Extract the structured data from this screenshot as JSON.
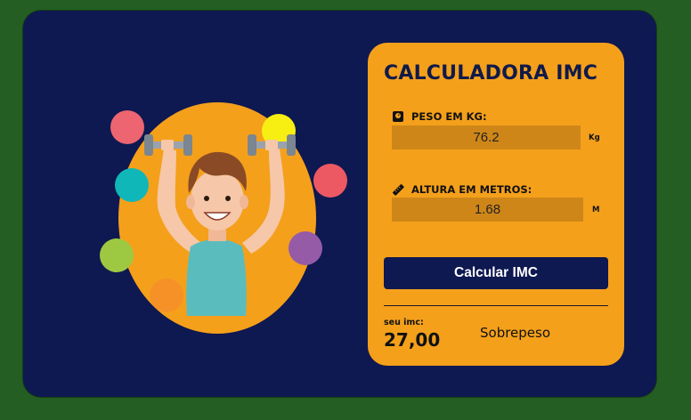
{
  "calculator": {
    "title": "CALCULADORA IMC",
    "weight": {
      "label": "PESO EM KG:",
      "value": "76.2",
      "unit": "Kg",
      "icon": "scale-icon"
    },
    "height": {
      "label": "ALTURA EM METROS:",
      "value": "1.68",
      "unit": "M",
      "icon": "ruler-icon"
    },
    "button_label": "Calcular IMC",
    "result": {
      "label": "seu imc:",
      "value": "27,00",
      "classification": "Sobrepeso"
    }
  },
  "colors": {
    "page_background": "#245e22",
    "card_background": "#0e1851",
    "panel_background": "#f4a01b",
    "field_background": "#cf8618",
    "button_background": "#0e1851"
  }
}
